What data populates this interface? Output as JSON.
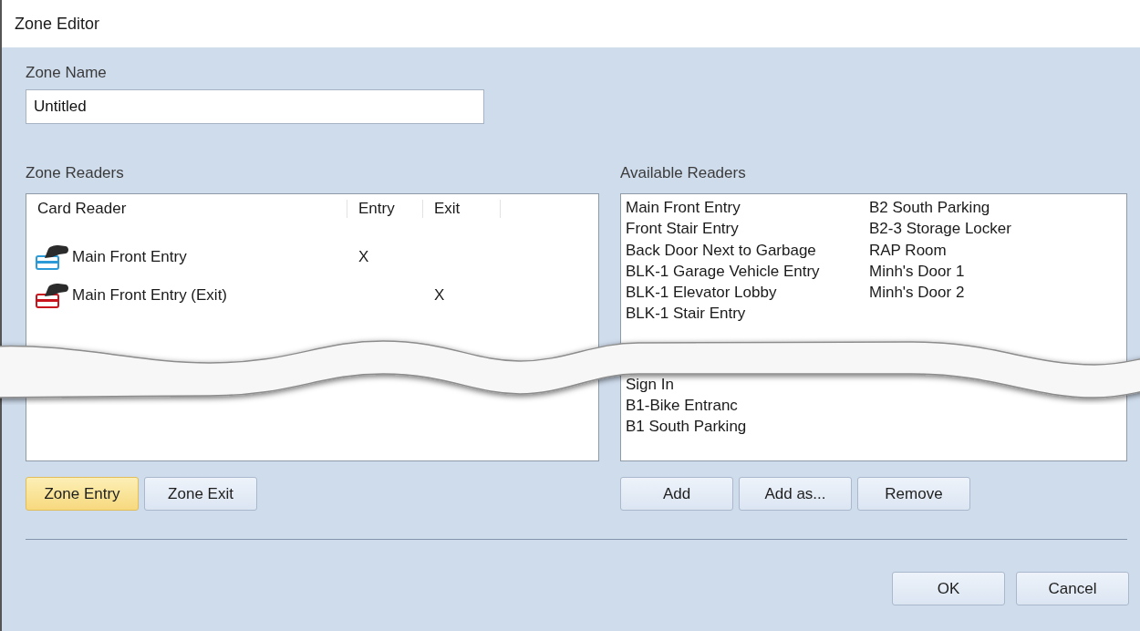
{
  "window": {
    "title": "Zone Editor"
  },
  "zone_name": {
    "label": "Zone Name",
    "value": "Untitled"
  },
  "zone_readers": {
    "label": "Zone Readers",
    "columns": [
      "Card Reader",
      "Entry",
      "Exit"
    ],
    "rows": [
      {
        "kind": "entry",
        "name": "Main Front Entry",
        "entry": "X",
        "exit": ""
      },
      {
        "kind": "exit",
        "name": "Main Front Entry (Exit)",
        "entry": "",
        "exit": "X"
      }
    ],
    "buttons": [
      {
        "label": "Zone Entry",
        "selected": true
      },
      {
        "label": "Zone Exit",
        "selected": false
      }
    ]
  },
  "available_readers": {
    "label": "Available Readers",
    "column_1_top": [
      "Main Front Entry",
      "Front Stair Entry",
      "Back Door Next to Garbage",
      "BLK-1 Garage Vehicle Entry",
      "BLK-1 Elevator Lobby",
      "BLK-1 Stair Entry"
    ],
    "column_2": [
      "B2 South Parking",
      "B2-3 Storage Locker",
      "RAP Room",
      "Minh's Door 1",
      "Minh's Door 2"
    ],
    "column_1_bottom": [
      "Sign In",
      "B1-Bike Entranc",
      "B1 South Parking"
    ],
    "buttons": [
      "Add",
      "Add as...",
      "Remove"
    ]
  },
  "dialog_buttons": [
    "OK",
    "Cancel"
  ]
}
